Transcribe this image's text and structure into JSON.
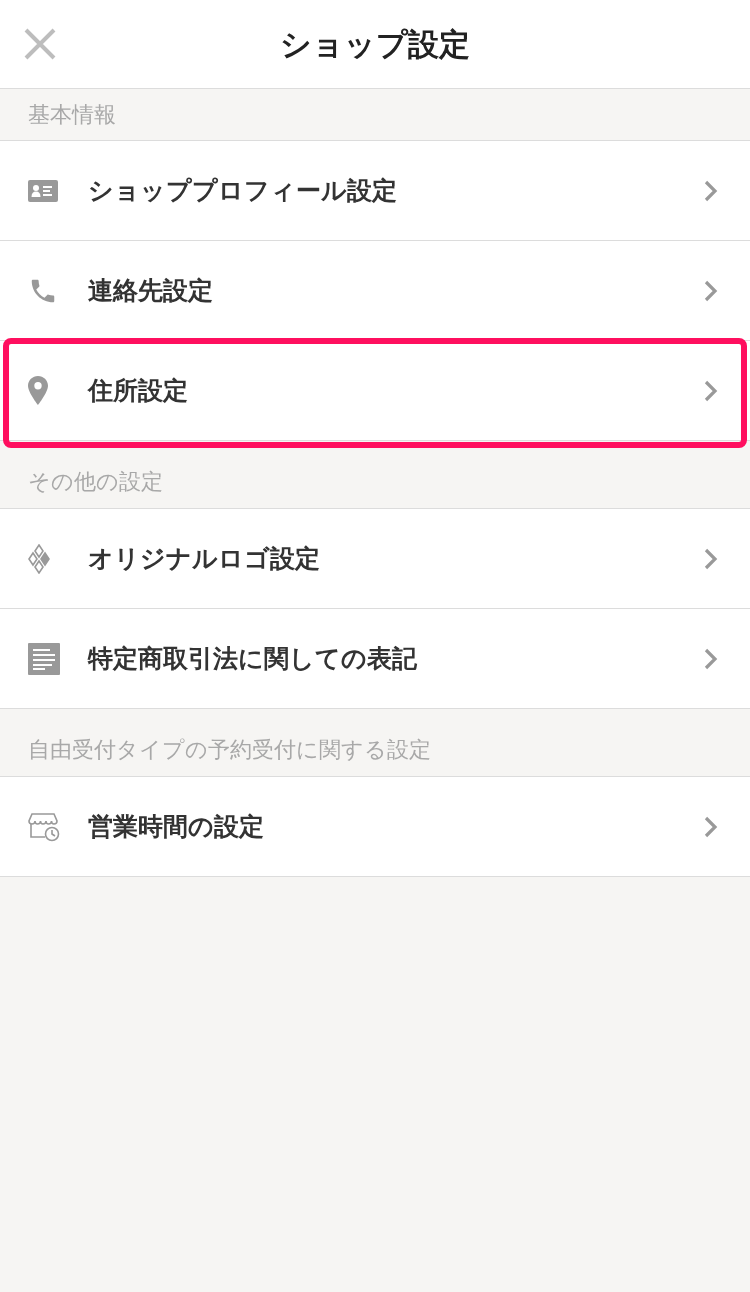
{
  "header": {
    "title": "ショップ設定"
  },
  "sections": [
    {
      "title": "基本情報",
      "items": [
        {
          "kind": "profile",
          "label": "ショッププロフィール設定",
          "highlighted": false
        },
        {
          "kind": "phone",
          "label": "連絡先設定",
          "highlighted": false
        },
        {
          "kind": "pin",
          "label": "住所設定",
          "highlighted": true
        }
      ]
    },
    {
      "title": "その他の設定",
      "items": [
        {
          "kind": "logo",
          "label": "オリジナルロゴ設定",
          "highlighted": false
        },
        {
          "kind": "document",
          "label": "特定商取引法に関しての表記",
          "highlighted": false
        }
      ]
    },
    {
      "title": "自由受付タイプの予約受付に関する設定",
      "items": [
        {
          "kind": "shop-hours",
          "label": "営業時間の設定",
          "highlighted": false
        }
      ]
    }
  ]
}
